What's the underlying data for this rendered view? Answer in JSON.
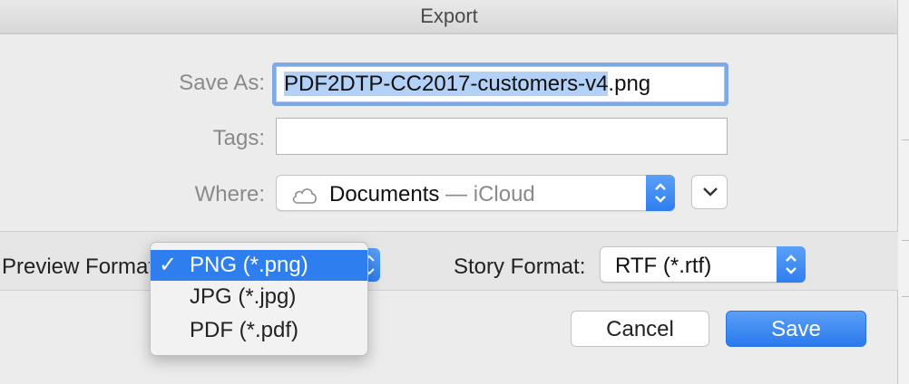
{
  "window": {
    "title": "Export"
  },
  "form": {
    "save_as_label": "Save As:",
    "save_as_selected": "PDF2DTP-CC2017-customers-v4",
    "save_as_extension": ".png",
    "tags_label": "Tags:",
    "tags_value": "",
    "where_label": "Where:",
    "where_location": "Documents",
    "where_separator": " — ",
    "where_service": "iCloud",
    "where_icon": "cloud-icon"
  },
  "options": {
    "preview_format_label": "Preview Format:",
    "preview_format_menu": [
      {
        "label": "PNG (*.png)",
        "selected": true
      },
      {
        "label": "JPG (*.jpg)",
        "selected": false
      },
      {
        "label": "PDF (*.pdf)",
        "selected": false
      }
    ],
    "check_mark": "✓",
    "story_format_label": "Story Format:",
    "story_format_value": "RTF (*.rtf)"
  },
  "buttons": {
    "cancel_label": "Cancel",
    "save_label": "Save"
  },
  "colors": {
    "accent": "#2f7ef0",
    "selection": "#b3d1f7",
    "focus_ring": "#7fa9e6"
  }
}
